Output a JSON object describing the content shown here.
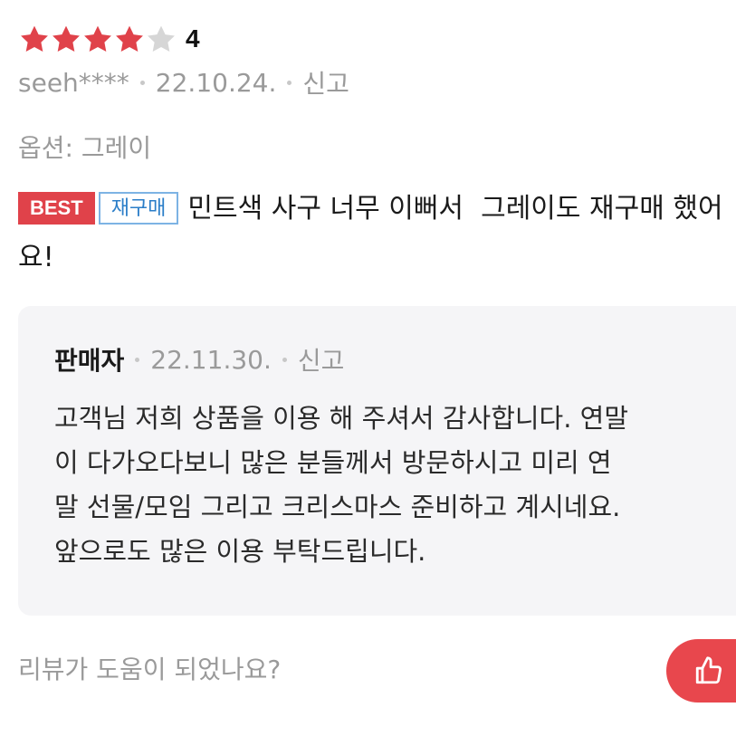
{
  "review": {
    "rating": 4,
    "rating_max": 5,
    "rating_label": "4",
    "user": "seeh****",
    "date": "22.10.24.",
    "report_label": "신고",
    "option": "옵션: 그레이",
    "badges": {
      "best": "BEST",
      "rebuy": "재구매"
    },
    "text": "민트색 사구 너무 이뻐서  그레이도 재구매 했어요!"
  },
  "reply": {
    "author": "판매자",
    "date": "22.11.30.",
    "report_label": "신고",
    "lines": [
      "고객님 저희 상품을 이용 해 주셔서 감사합니다. 연말",
      "이 다가오다보니 많은 분들께서 방문하시고 미리 연",
      "말 선물/모임 그리고 크리스마스 준비하고 계시네요.",
      "앞으로도 많은 이용 부탁드립니다."
    ]
  },
  "helpful": {
    "question": "리뷰가 도움이 되었나요?",
    "like_icon": "thumbs-up-icon"
  },
  "colors": {
    "star_filled": "#e0424a",
    "star_empty": "#d6d6d6",
    "accent": "#e8474d",
    "badge_best": "#e0424a",
    "badge_rebuy": "#2b7ec8",
    "reply_background": "#f5f5f7"
  }
}
